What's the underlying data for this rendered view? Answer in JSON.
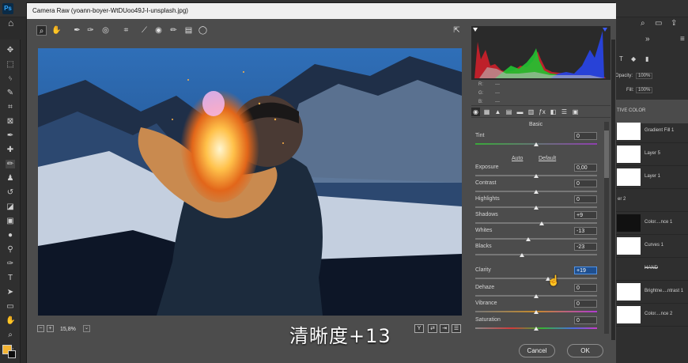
{
  "app": {
    "logo": "Ps"
  },
  "dialog": {
    "title": "Camera Raw (yoann-boyer-WtDUoo49J-I-unsplash.jpg)",
    "toolbar_icons": [
      "zoom-tool-icon",
      "hand-tool-icon",
      "white-balance-tool-icon",
      "color-sampler-icon",
      "targeted-adjustment-icon",
      "crop-tool-icon",
      "straighten-tool-icon",
      "red-eye-icon",
      "adjustment-brush-icon",
      "graduated-filter-icon",
      "radial-filter-icon"
    ],
    "open_preferences_icon": "export-icon"
  },
  "histogram": {
    "rgb": [
      {
        "label": "R:",
        "value": "---"
      },
      {
        "label": "G:",
        "value": "---"
      },
      {
        "label": "B:",
        "value": "---"
      }
    ]
  },
  "panel": {
    "section": "Basic",
    "auto_label": "Auto",
    "default_label": "Default",
    "controls": [
      {
        "label": "Tint",
        "value": "0",
        "level": 0.5
      },
      {
        "label": "Exposure",
        "value": "0,00",
        "level": 0.5
      },
      {
        "label": "Contrast",
        "value": "0",
        "level": 0.5
      },
      {
        "label": "Highlights",
        "value": "0",
        "level": 0.5
      },
      {
        "label": "Shadows",
        "value": "+9",
        "level": 0.545
      },
      {
        "label": "Whites",
        "value": "-13",
        "level": 0.435
      },
      {
        "label": "Blacks",
        "value": "-23",
        "level": 0.385
      },
      {
        "label": "Clarity",
        "value": "+19",
        "level": 0.595
      },
      {
        "label": "Dehaze",
        "value": "0",
        "level": 0.5
      },
      {
        "label": "Vibrance",
        "value": "0",
        "level": 0.5
      },
      {
        "label": "Saturation",
        "value": "0",
        "level": 0.5
      }
    ]
  },
  "preview": {
    "zoom": "15,8%",
    "view_buttons": [
      "Y"
    ]
  },
  "buttons": {
    "cancel": "Cancel",
    "ok": "OK"
  },
  "caption": "清晰度+13",
  "ps_panels": {
    "opacity_label": "Opacity:",
    "opacity_value": "100%",
    "fill_label": "Fill:",
    "fill_value": "100%",
    "header_fragment": "TIVE COLOR",
    "layers": [
      {
        "name": "Gradient Fill 1"
      },
      {
        "name": "Layer 5"
      },
      {
        "name": "Layer 1"
      },
      {
        "name": "er 2"
      },
      {
        "name": "Color....nce 1"
      },
      {
        "name": "Curves 1"
      },
      {
        "name": "HAND"
      },
      {
        "name": "Brightne....ntrast 1"
      },
      {
        "name": "Color....nce 2"
      }
    ]
  }
}
